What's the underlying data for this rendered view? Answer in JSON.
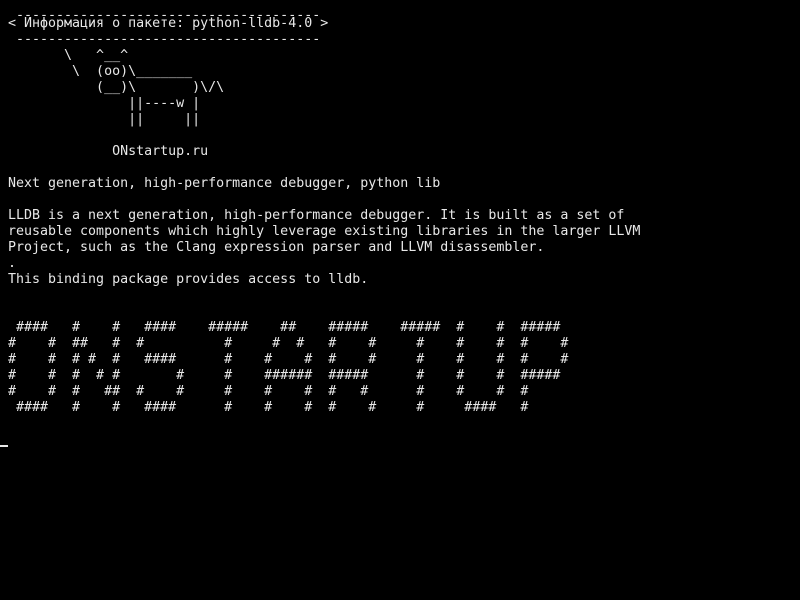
{
  "colors": {
    "background": "#000000",
    "foreground": "#e8e8e8"
  },
  "terminal": {
    "lines": [
      " -------------------------------------- ",
      "< Информация о пакете: python-lldb-4.0 >",
      " -------------------------------------- ",
      "       \\   ^__^",
      "        \\  (oo)\\_______",
      "           (__)\\       )\\/\\",
      "               ||----w |",
      "               ||     ||",
      "",
      "             ONstartup.ru",
      "",
      "Next generation, high-performance debugger, python lib",
      "",
      "LLDB is a next generation, high-performance debugger. It is built as a set of",
      "reusable components which highly leverage existing libraries in the larger LLVM",
      "Project, such as the Clang expression parser and LLVM disassembler.",
      ".",
      "This binding package provides access to lldb.",
      "",
      "",
      " ####   #    #   ####    #####    ##    #####    #####  #    #  #####",
      "#    #  ##   #  #          #     #  #   #    #     #    #    #  #    #",
      "#    #  # #  #   ####      #    #    #  #    #     #    #    #  #    #",
      "#    #  #  # #       #     #    ######  #####      #    #    #  #####",
      "#    #  #   ##  #    #     #    #    #  #   #      #    #    #  #",
      " ####   #    #   ####      #    #    #  #    #     #     ####   #"
    ]
  }
}
